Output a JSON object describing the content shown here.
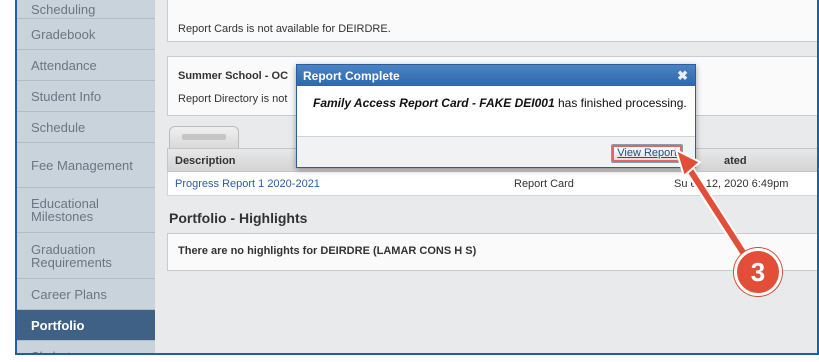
{
  "sidebar": {
    "items": [
      {
        "label": "Scheduling"
      },
      {
        "label": "Gradebook"
      },
      {
        "label": "Attendance"
      },
      {
        "label": "Student Info"
      },
      {
        "label": "Schedule"
      },
      {
        "label": "Fee Management"
      },
      {
        "label": "Educational Milestones"
      },
      {
        "label": "Graduation Requirements"
      },
      {
        "label": "Career Plans"
      },
      {
        "label": "Portfolio"
      },
      {
        "label": "Skylert"
      }
    ]
  },
  "main": {
    "report_cards_msg": "Report Cards is not available for DEIRDRE.",
    "summer_school_title": "Summer School - OC",
    "report_directory_msg": "Report Directory is not",
    "table": {
      "headers": [
        "Description",
        "ated"
      ],
      "row": {
        "description": "Progress Report 1 2020-2021",
        "type": "Report Card",
        "date": "Su    ep 12, 2020 6:49pm"
      }
    },
    "portfolio_heading": "Portfolio - Highlights",
    "highlights_msg": "There are no highlights for DEIRDRE (LAMAR CONS H S)"
  },
  "dialog": {
    "title": "Report Complete",
    "close_icon": "✖",
    "message_italic": "Family Access Report Card - FAKE DEI001",
    "message_rest": " has finished processing.",
    "button_label": "View Report"
  },
  "annotation": {
    "step_number": "3",
    "arrow_color": "#e24e37"
  }
}
